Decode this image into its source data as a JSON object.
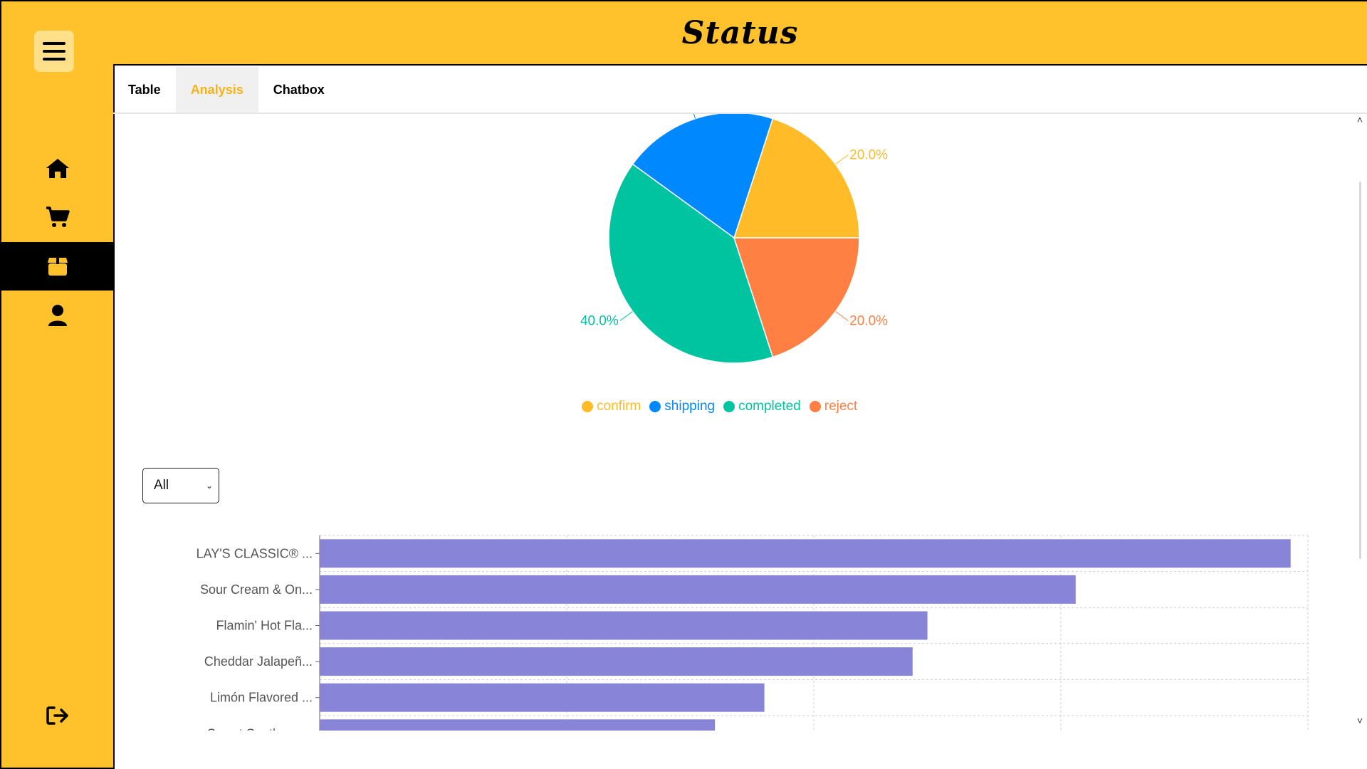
{
  "header": {
    "title": "Status"
  },
  "tabs": [
    {
      "label": "Table"
    },
    {
      "label": "Analysis"
    },
    {
      "label": "Chatbox"
    }
  ],
  "sidebar": {
    "items": [
      {
        "icon": "home-icon"
      },
      {
        "icon": "cart-icon"
      },
      {
        "icon": "box-icon",
        "active": true
      },
      {
        "icon": "user-icon"
      }
    ],
    "logout_icon": "logout-icon"
  },
  "filter": {
    "selected": "All"
  },
  "colors": {
    "accent": "#ffc22d",
    "confirm": "#ffbb28",
    "shipping": "#0088fe",
    "completed": "#00c49f",
    "reject": "#ff8042",
    "bar": "#8884d8"
  },
  "chart_data": [
    {
      "type": "pie",
      "slices": [
        {
          "name": "confirm",
          "value": 20,
          "label": "20.0%",
          "color": "#ffbb28"
        },
        {
          "name": "shipping",
          "value": 20,
          "label": "",
          "color": "#0088fe"
        },
        {
          "name": "completed",
          "value": 40,
          "label": "40.0%",
          "color": "#00c49f"
        },
        {
          "name": "reject",
          "value": 20,
          "label": "20.0%",
          "color": "#ff8042"
        }
      ],
      "legend": [
        "confirm",
        "shipping",
        "completed",
        "reject"
      ],
      "legend_position": "bottom"
    },
    {
      "type": "bar",
      "orientation": "horizontal",
      "categories": [
        "LAY'S CLASSIC® ...",
        "Sour Cream & On...",
        "Flamin' Hot Fla...",
        "Cheddar Jalapeñ...",
        "Limón Flavored ...",
        "Sweet Southern ..."
      ],
      "values": [
        3.93,
        3.06,
        2.46,
        2.4,
        1.8,
        1.6
      ],
      "xlim": [
        0,
        4
      ],
      "grid": true
    }
  ]
}
